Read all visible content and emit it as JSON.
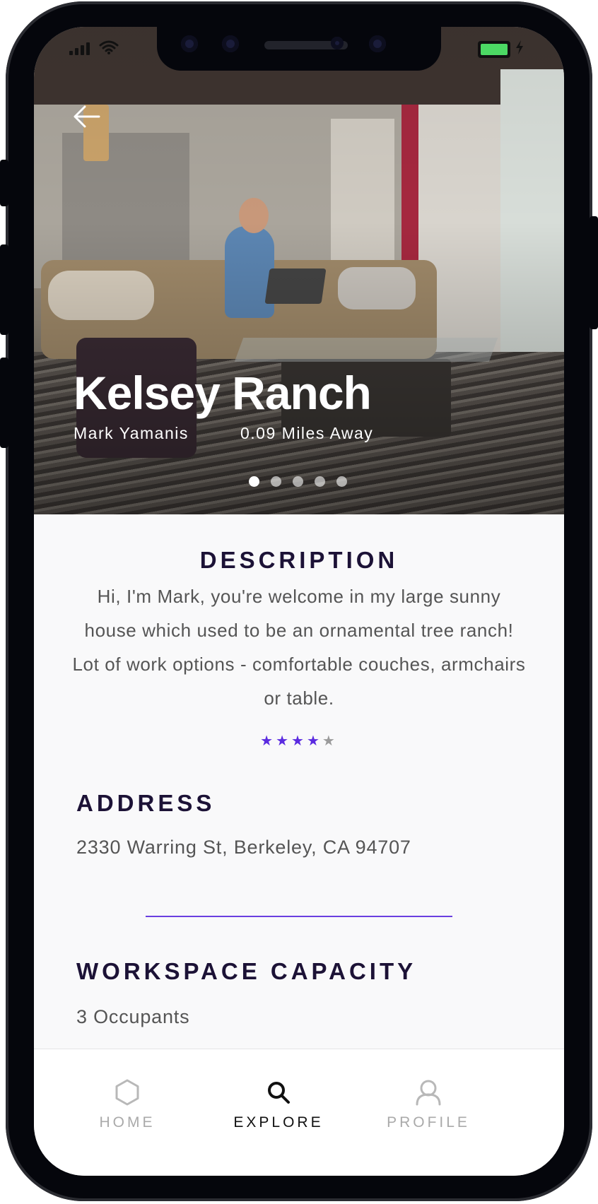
{
  "listing": {
    "title": "Kelsey Ranch",
    "host": "Mark Yamanis",
    "distance": "0.09 Miles Away",
    "carousel": {
      "total": 5,
      "active_index": 0
    }
  },
  "description": {
    "heading": "DESCRIPTION",
    "text": "Hi, I'm Mark, you're welcome in my large sunny house which used to be an ornamental tree ranch! Lot of work options - comfortable couches, armchairs or table.",
    "rating": {
      "value": 4,
      "max": 5
    }
  },
  "address": {
    "heading": "ADDRESS",
    "text": "2330 Warring St, Berkeley, CA 94707"
  },
  "capacity": {
    "heading": "WORKSPACE CAPACITY",
    "text": "3 Occupants"
  },
  "tabbar": {
    "items": [
      {
        "label": "HOME",
        "icon": "hexagon-icon",
        "active": false
      },
      {
        "label": "EXPLORE",
        "icon": "search-icon",
        "active": true
      },
      {
        "label": "PROFILE",
        "icon": "user-icon",
        "active": false
      }
    ]
  },
  "colors": {
    "accent": "#5b2be0",
    "heading": "#1c1236",
    "body_text": "#555555",
    "battery": "#4cd964"
  }
}
